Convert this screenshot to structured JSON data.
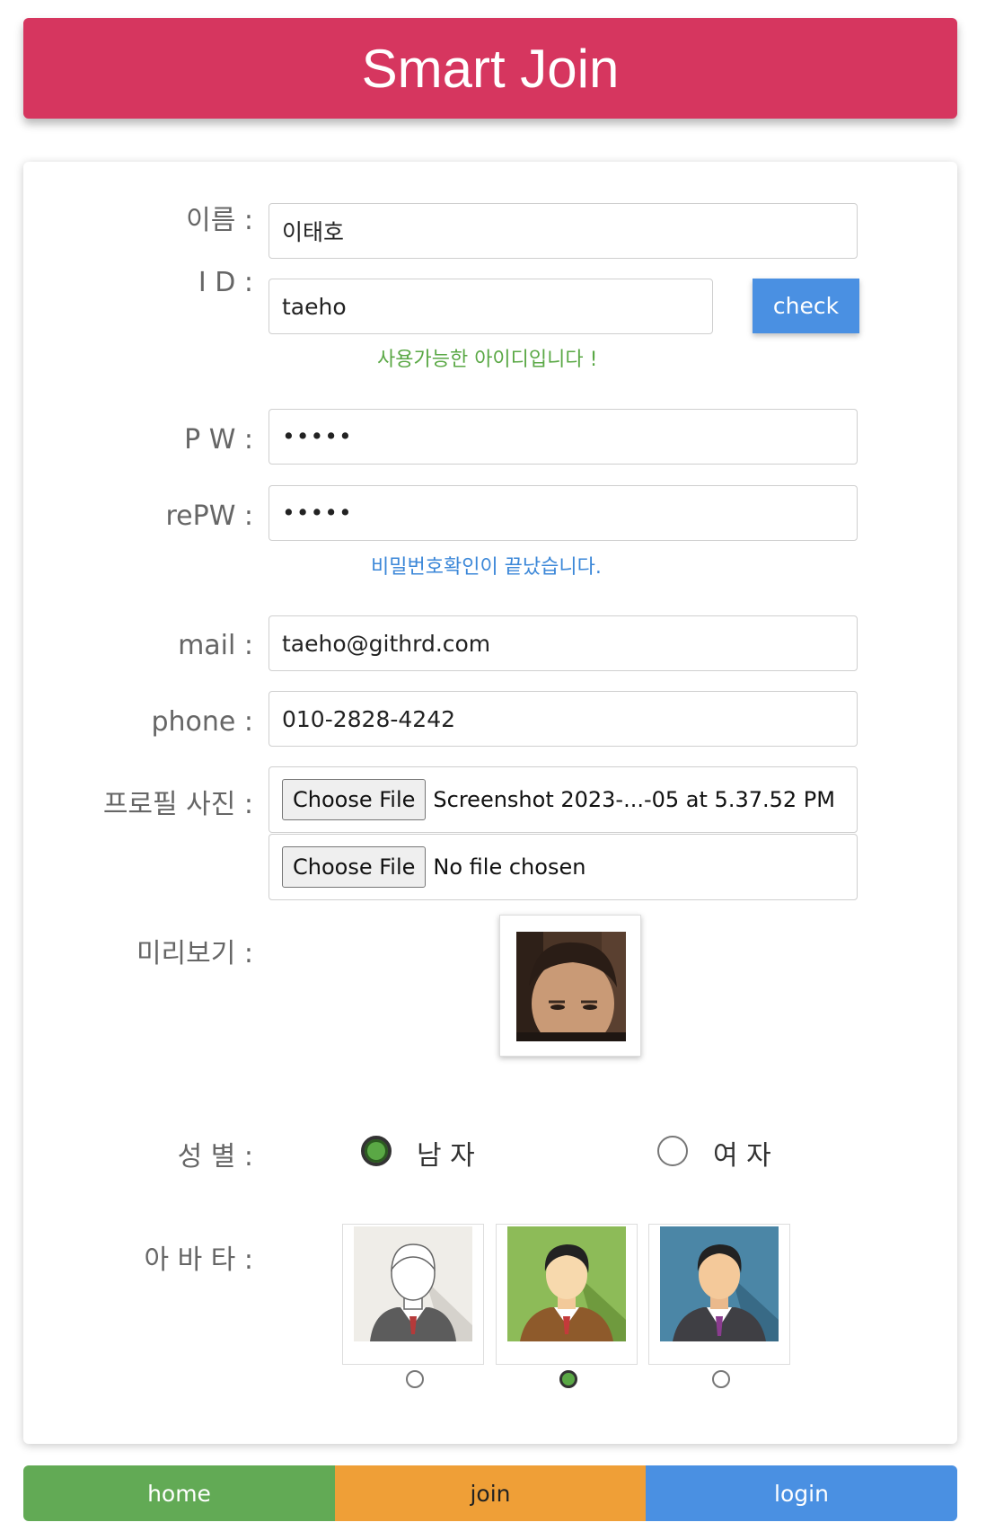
{
  "header": {
    "title": "Smart Join"
  },
  "form": {
    "name": {
      "label": "이름 :",
      "value": "이태호"
    },
    "id": {
      "label": "I D :",
      "value": "taeho",
      "check_label": "check",
      "message": "사용가능한 아이디입니다 !"
    },
    "pw": {
      "label": "P W :",
      "value": "•••••"
    },
    "repw": {
      "label": "rePW :",
      "value": "•••••",
      "message": "비밀번호확인이 끝났습니다."
    },
    "mail": {
      "label": "mail :",
      "value": "taeho@githrd.com"
    },
    "phone": {
      "label": "phone :",
      "value": "010-2828-4242"
    },
    "profile": {
      "label": "프로필 사진 :",
      "files": [
        {
          "button": "Choose File",
          "filename": "Screenshot 2023-...-05 at 5.37.52 PM"
        },
        {
          "button": "Choose File",
          "filename": "No file chosen"
        }
      ]
    },
    "preview": {
      "label": "미리보기 :"
    },
    "gender": {
      "label": "성 별 :",
      "options": [
        {
          "text": "남 자",
          "selected": true
        },
        {
          "text": "여 자",
          "selected": false
        }
      ]
    },
    "avatar": {
      "label": "아 바 타 :",
      "options": [
        {
          "icon": "avatar-white-icon",
          "selected": false
        },
        {
          "icon": "avatar-green-icon",
          "selected": true
        },
        {
          "icon": "avatar-blue-icon",
          "selected": false
        }
      ]
    }
  },
  "nav": {
    "home": "home",
    "join": "join",
    "login": "login"
  },
  "colors": {
    "header": "#d6365f",
    "check": "#4a90e2",
    "ok_msg": "#5aa845",
    "info_msg": "#3b87d8",
    "home": "#62aa55",
    "join": "#ef9f37",
    "login": "#4a90e2"
  }
}
